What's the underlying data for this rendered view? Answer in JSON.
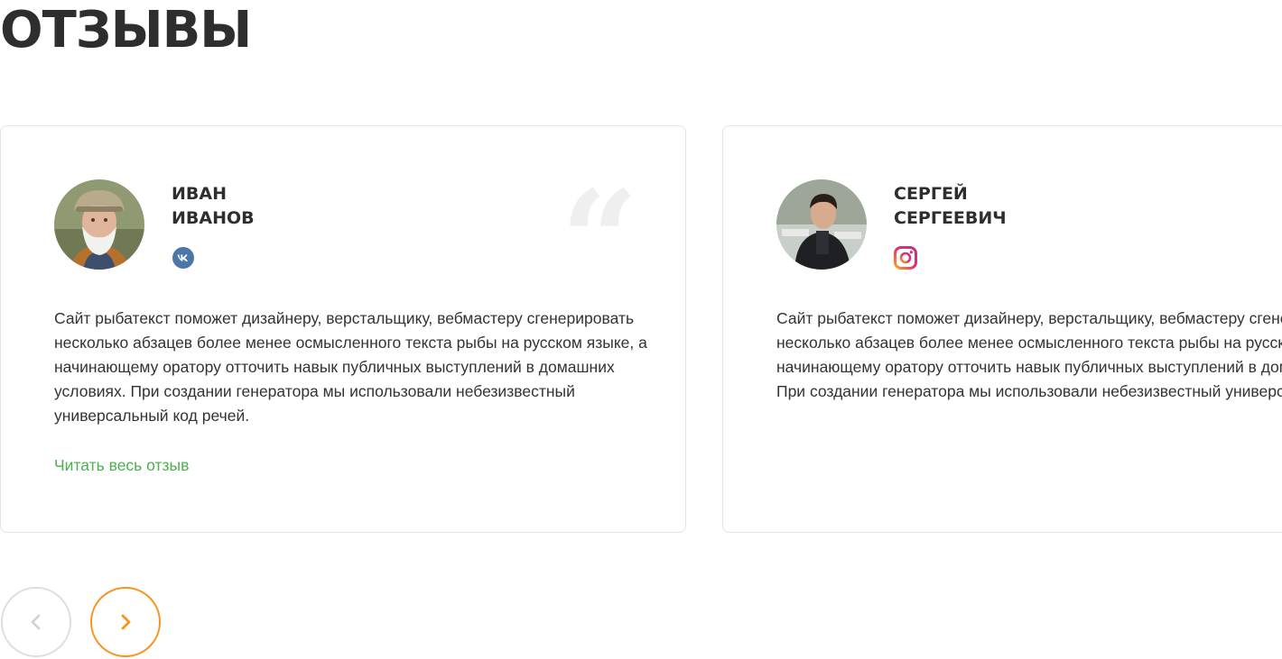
{
  "section": {
    "title": "ОТЗЫВЫ"
  },
  "reviews": [
    {
      "name_line1": "ИВАН",
      "name_line2": "ИВАНОВ",
      "social_icon": "vk-icon",
      "quote_mark": "“",
      "text": "Сайт рыбатекст поможет дизайнеру, верстальщику, вебмастеру сгенерировать несколько абзацев более менее осмысленного текста рыбы на русском языке, а начинающему оратору отточить навык публичных выступлений в домашних условиях. При создании генератора мы использовали небезизвестный универсальный код речей.",
      "read_more": "Читать весь отзыв"
    },
    {
      "name_line1": "СЕРГЕЙ",
      "name_line2": "СЕРГЕЕВИЧ",
      "social_icon": "instagram-icon",
      "text": "Сайт рыбатекст поможет дизайнеру, верстальщику, вебмастеру сгенерировать несколько абзацев более менее осмысленного текста рыбы на русском языке, а начинающему оратору отточить навык публичных выступлений в домашних условиях. При создании генератора мы использовали небезизвестный универсальный код речей."
    }
  ],
  "navigation": {
    "prev_icon": "chevron-left-icon",
    "next_icon": "chevron-right-icon"
  },
  "colors": {
    "accent_orange": "#f7931e",
    "link_green": "#4caf50",
    "vk_blue": "#4a76a8",
    "card_border": "#e3e3e3",
    "text": "#333333"
  }
}
